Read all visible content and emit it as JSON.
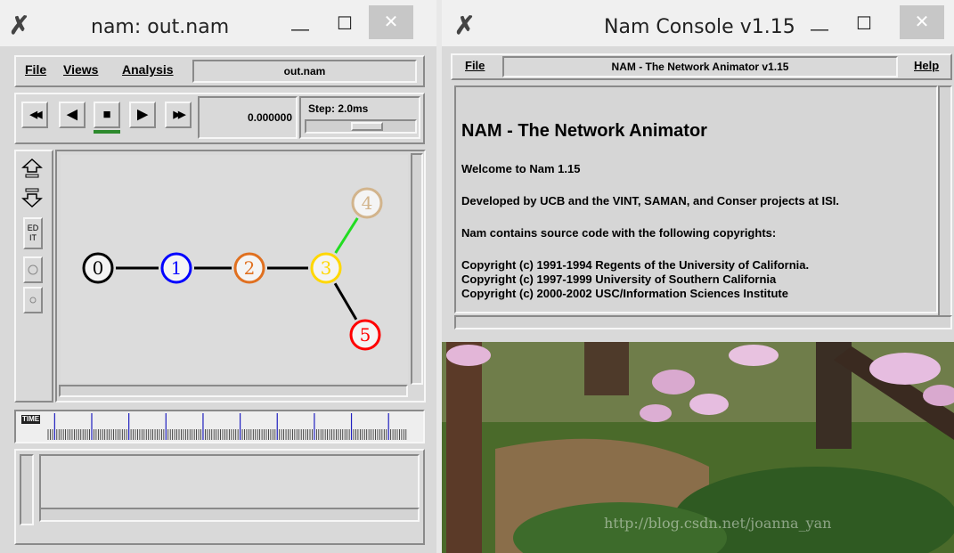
{
  "left_window": {
    "title": "nam: out.nam",
    "menu": {
      "file": "File",
      "views": "Views",
      "analysis": "Analysis"
    },
    "filename": "out.nam",
    "controls": {
      "rewind": "◀◀",
      "back": "◀",
      "stop": "■",
      "play": "▶",
      "fast_forward": "▶▶",
      "time": "0.000000",
      "step_label": "Step: 2.0ms"
    },
    "side_tools": {
      "edit_label_top": "ED",
      "edit_label_bottom": "IT"
    },
    "timeline_label": "TIME",
    "nodes": [
      {
        "id": "0",
        "color": "#000000"
      },
      {
        "id": "1",
        "color": "#0000ff"
      },
      {
        "id": "2",
        "color": "#e07020"
      },
      {
        "id": "3",
        "color": "#ffd700"
      },
      {
        "id": "4",
        "color": "#d2b48c"
      },
      {
        "id": "5",
        "color": "#ff0000"
      }
    ],
    "links": [
      {
        "from": "0",
        "to": "1",
        "color": "#000000"
      },
      {
        "from": "1",
        "to": "2",
        "color": "#000000"
      },
      {
        "from": "2",
        "to": "3",
        "color": "#000000"
      },
      {
        "from": "3",
        "to": "4",
        "color": "#22dd22"
      },
      {
        "from": "3",
        "to": "5",
        "color": "#000000"
      }
    ]
  },
  "right_window": {
    "title": "Nam Console v1.15",
    "menu": {
      "file": "File",
      "help": "Help"
    },
    "header_field": "NAM - The Network Animator v1.15",
    "console": {
      "heading": "NAM - The Network Animator",
      "line1": "Welcome to Nam 1.15",
      "line2": "Developed by UCB and the VINT, SAMAN, and Conser projects at ISI.",
      "line3": "Nam contains source code with the following copyrights:",
      "copyright1": "Copyright (c) 1991-1994 Regents of the University of California.",
      "copyright2": "Copyright (c) 1997-1999 University of Southern California",
      "copyright3": "Copyright (c) 2000-2002 USC/Information Sciences Institute"
    }
  },
  "titlebar_buttons": {
    "minimize": "—",
    "maximize": "☐",
    "close": "✕"
  },
  "watermark": "http://blog.csdn.net/joanna_yan"
}
